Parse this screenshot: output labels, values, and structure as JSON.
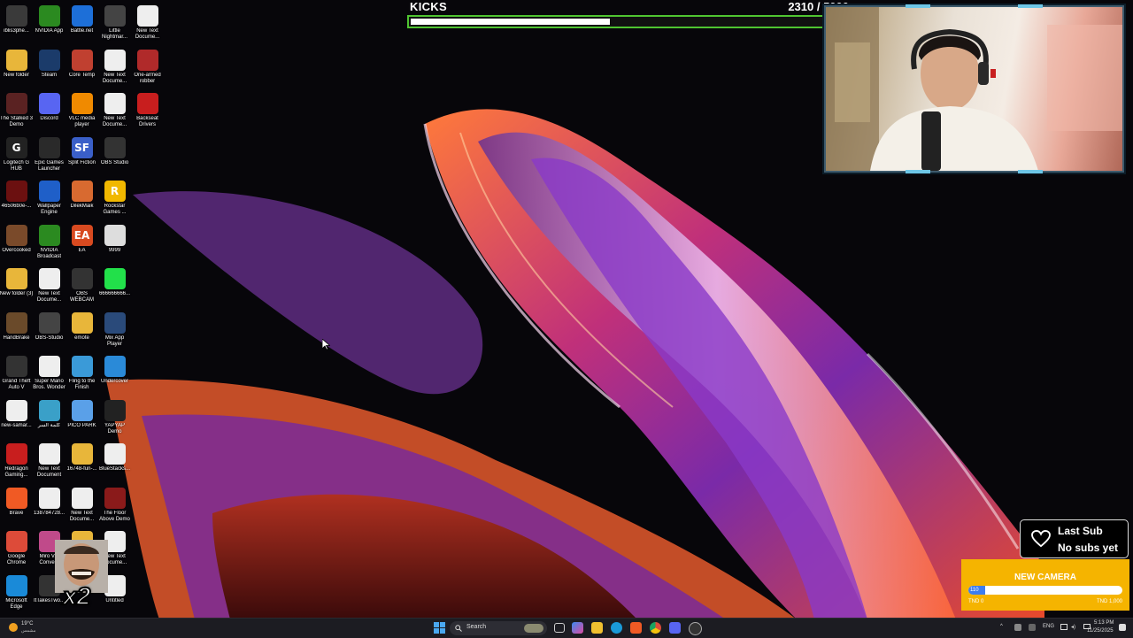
{
  "desktop": {
    "icons": [
      {
        "label": "iblis3phe...",
        "color": "#3a3a3a",
        "glyph": ""
      },
      {
        "label": "NVIDIA App",
        "color": "#2b8a20",
        "glyph": ""
      },
      {
        "label": "Battle.net",
        "color": "#1d6fd8",
        "glyph": ""
      },
      {
        "label": "Little Nightmar...",
        "color": "#444",
        "glyph": ""
      },
      {
        "label": "New Text Docume...",
        "color": "#eee",
        "glyph": ""
      },
      {
        "label": "New folder",
        "color": "#e8b63a",
        "glyph": ""
      },
      {
        "label": "Steam",
        "color": "#1b3b6a",
        "glyph": ""
      },
      {
        "label": "Core Temp",
        "color": "#c04030",
        "glyph": ""
      },
      {
        "label": "New Text Docume...",
        "color": "#eee",
        "glyph": ""
      },
      {
        "label": "One-armed robber",
        "color": "#b02a2a",
        "glyph": ""
      },
      {
        "label": "The Stalked 3 Demo",
        "color": "#5a2222",
        "glyph": ""
      },
      {
        "label": "Discord",
        "color": "#5865f2",
        "glyph": ""
      },
      {
        "label": "VLC media player",
        "color": "#f08a00",
        "glyph": ""
      },
      {
        "label": "New Text Docume...",
        "color": "#eee",
        "glyph": ""
      },
      {
        "label": "Backseat Drivers",
        "color": "#c81e1e",
        "glyph": ""
      },
      {
        "label": "Logitech G HUB",
        "color": "#222",
        "glyph": "G"
      },
      {
        "label": "Epic Games Launcher",
        "color": "#2a2a2a",
        "glyph": ""
      },
      {
        "label": "Split Fiction",
        "color": "#3a5fc8",
        "glyph": "SF"
      },
      {
        "label": "OBS Studio",
        "color": "#333",
        "glyph": ""
      },
      {
        "label": "",
        "color": "#000",
        "glyph": ""
      },
      {
        "label": "46506b0e-...",
        "color": "#6b1010",
        "glyph": ""
      },
      {
        "label": "Wallpaper Engine",
        "color": "#1f5fc8",
        "glyph": ""
      },
      {
        "label": "DilekMaik",
        "color": "#d86a30",
        "glyph": ""
      },
      {
        "label": "Rockstar Games ...",
        "color": "#f1b800",
        "glyph": "R"
      },
      {
        "label": "",
        "color": "#000",
        "glyph": ""
      },
      {
        "label": "Overcooked",
        "color": "#7a4a2a",
        "glyph": ""
      },
      {
        "label": "NVIDIA Broadcast",
        "color": "#2b8a20",
        "glyph": ""
      },
      {
        "label": "EA",
        "color": "#d84a20",
        "glyph": "EA"
      },
      {
        "label": "9999",
        "color": "#ddd",
        "glyph": ""
      },
      {
        "label": "",
        "color": "#000",
        "glyph": ""
      },
      {
        "label": "New folder (3)",
        "color": "#e8b63a",
        "glyph": ""
      },
      {
        "label": "New Text Docume...",
        "color": "#eee",
        "glyph": ""
      },
      {
        "label": "OBS WEBCAM",
        "color": "#333",
        "glyph": ""
      },
      {
        "label": "666666666...",
        "color": "#22e04a",
        "glyph": ""
      },
      {
        "label": "",
        "color": "#000",
        "glyph": ""
      },
      {
        "label": "HandBrake",
        "color": "#6a4a2a",
        "glyph": ""
      },
      {
        "label": "OBS-Studio",
        "color": "#444",
        "glyph": ""
      },
      {
        "label": "emote",
        "color": "#e8b63a",
        "glyph": ""
      },
      {
        "label": "Mix App Player",
        "color": "#2a4a7a",
        "glyph": ""
      },
      {
        "label": "",
        "color": "#000",
        "glyph": ""
      },
      {
        "label": "Grand Theft Auto V",
        "color": "#333",
        "glyph": ""
      },
      {
        "label": "Super Mario Bros. Wonder",
        "color": "#eee",
        "glyph": ""
      },
      {
        "label": "Fling to the Finish",
        "color": "#3a9ad8",
        "glyph": ""
      },
      {
        "label": "Undercover",
        "color": "#2a8ad8",
        "glyph": ""
      },
      {
        "label": "",
        "color": "#000",
        "glyph": ""
      },
      {
        "label": "new-samar...",
        "color": "#eee",
        "glyph": ""
      },
      {
        "label": "كلمة السر",
        "color": "#3aa0c8",
        "glyph": ""
      },
      {
        "label": "PICO PARK",
        "color": "#5aa0e8",
        "glyph": ""
      },
      {
        "label": "YAPYAP Demo",
        "color": "#222",
        "glyph": ""
      },
      {
        "label": "",
        "color": "#000",
        "glyph": ""
      },
      {
        "label": "Redragon Gaming...",
        "color": "#c81e1e",
        "glyph": ""
      },
      {
        "label": "New Text Document",
        "color": "#eee",
        "glyph": ""
      },
      {
        "label": "16748-fun-...",
        "color": "#e8b63a",
        "glyph": ""
      },
      {
        "label": "BlueStacks...",
        "color": "#eee",
        "glyph": ""
      },
      {
        "label": "",
        "color": "#000",
        "glyph": ""
      },
      {
        "label": "Brave",
        "color": "#f05a24",
        "glyph": ""
      },
      {
        "label": "138784728...",
        "color": "#eee",
        "glyph": ""
      },
      {
        "label": "New Text Docume...",
        "color": "#eee",
        "glyph": ""
      },
      {
        "label": "The Floor Above Demo",
        "color": "#8a1a1a",
        "glyph": ""
      },
      {
        "label": "",
        "color": "#000",
        "glyph": ""
      },
      {
        "label": "Google Chrome",
        "color": "#dd4b39",
        "glyph": ""
      },
      {
        "label": "Miro V... Conve...",
        "color": "#c04a8a",
        "glyph": ""
      },
      {
        "label": "",
        "color": "#e8b63a",
        "glyph": ""
      },
      {
        "label": "New Text Docume...",
        "color": "#eee",
        "glyph": ""
      },
      {
        "label": "",
        "color": "#000",
        "glyph": ""
      },
      {
        "label": "Microsoft Edge",
        "color": "#1a8ad8",
        "glyph": ""
      },
      {
        "label": "ItTakesTwo...",
        "color": "#333",
        "glyph": ""
      },
      {
        "label": "",
        "color": "#000",
        "glyph": ""
      },
      {
        "label": "Untitled",
        "color": "#eee",
        "glyph": ""
      }
    ]
  },
  "kicks_goal": {
    "title": "KICKS",
    "count_text": "2310  / 5000",
    "current": 2310,
    "target": 5000,
    "color": "#4fc431"
  },
  "last_sub": {
    "title": "Last Sub",
    "value": "No subs yet"
  },
  "new_camera": {
    "title": "NEW CAMERA",
    "current_text": "110",
    "min_label": "TND 0",
    "max_label": "TND 1,000",
    "progress": 0.11,
    "color": "#f5b400"
  },
  "meme_overlay": {
    "multiplier": "x2"
  },
  "taskbar": {
    "weather": "19°C",
    "weather_sub": "مشمس",
    "search_label": "Search",
    "language": "ENG",
    "time": "5:13 PM",
    "date": "11/25/2025"
  }
}
